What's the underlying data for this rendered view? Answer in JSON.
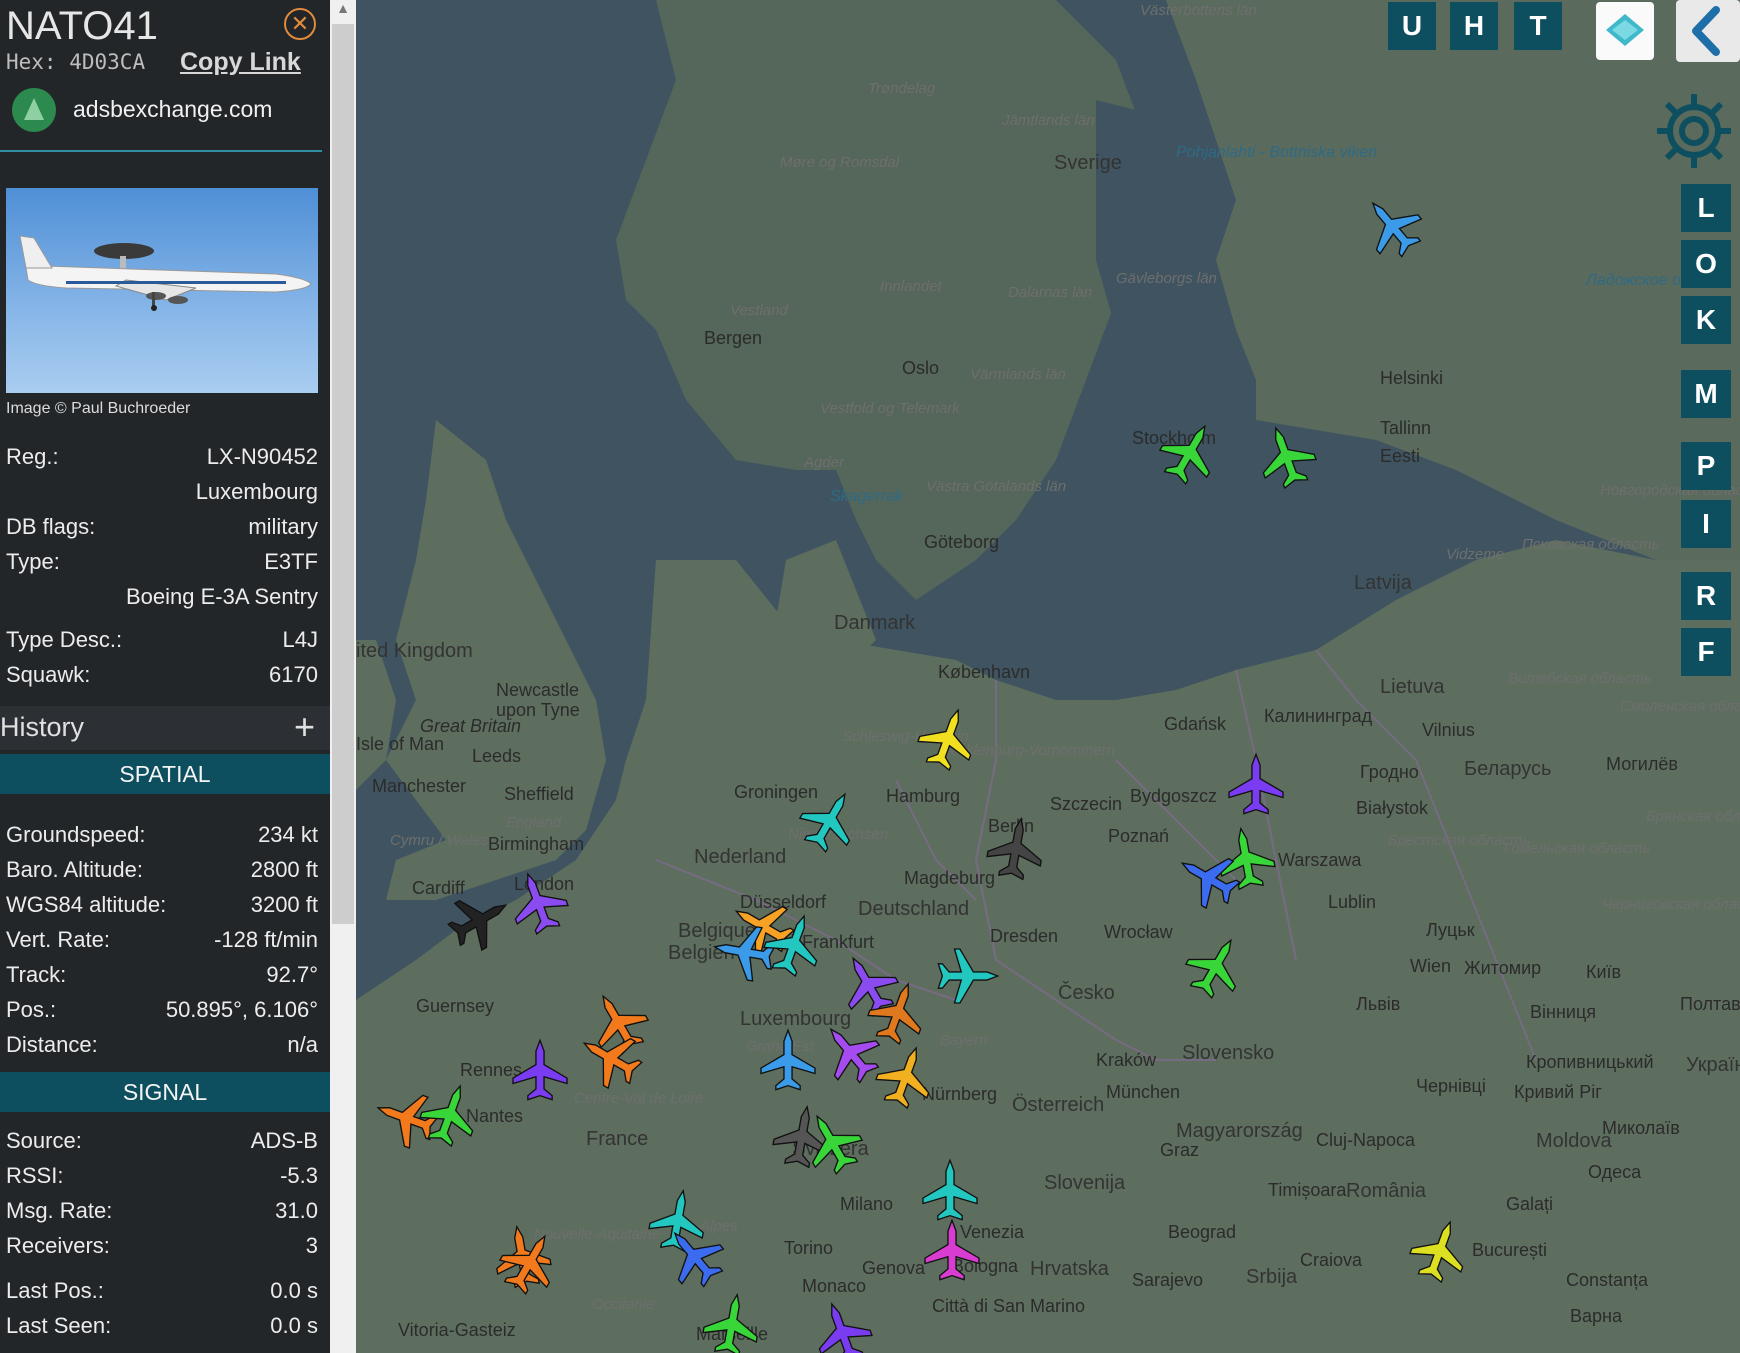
{
  "aircraft": {
    "callsign": "NATO41",
    "hex_label": "Hex:",
    "hex": "4D03CA",
    "copy_link": "Copy Link",
    "site": "adsbexchange.com",
    "photo_credit": "Image © Paul Buchroeder"
  },
  "info": [
    {
      "label": "Reg.:",
      "value": "LX-N90452"
    },
    {
      "label": "",
      "value": "Luxembourg"
    },
    {
      "label": "DB flags:",
      "value": "military"
    },
    {
      "label": "Type:",
      "value": "E3TF"
    },
    {
      "label": "",
      "value": "Boeing E-3A Sentry"
    },
    {
      "label": "Type Desc.:",
      "value": "L4J"
    },
    {
      "label": "Squawk:",
      "value": "6170"
    }
  ],
  "history": {
    "title": "History",
    "expand": "+"
  },
  "spatial": {
    "title": "SPATIAL",
    "rows": [
      {
        "label": "Groundspeed:",
        "value": "234 kt"
      },
      {
        "label": "Baro. Altitude:",
        "value": "2800 ft"
      },
      {
        "label": "WGS84 altitude:",
        "value": "3200 ft"
      },
      {
        "label": "Vert. Rate:",
        "value": "-128 ft/min"
      },
      {
        "label": "Track:",
        "value": "92.7°"
      },
      {
        "label": "Pos.:",
        "value": "50.895°, 6.106°"
      },
      {
        "label": "Distance:",
        "value": "n/a"
      }
    ]
  },
  "signal": {
    "title": "SIGNAL",
    "rows": [
      {
        "label": "Source:",
        "value": "ADS-B"
      },
      {
        "label": "RSSI:",
        "value": "-5.3"
      },
      {
        "label": "Msg. Rate:",
        "value": "31.0"
      },
      {
        "label": "Receivers:",
        "value": "3"
      },
      {
        "label": "Last Pos.:",
        "value": "0.0 s"
      },
      {
        "label": "Last Seen:",
        "value": "0.0 s"
      }
    ]
  },
  "map": {
    "top_buttons": [
      "U",
      "H",
      "T"
    ],
    "right_buttons": [
      "L",
      "O",
      "K",
      "M",
      "P",
      "I",
      "R",
      "F"
    ],
    "labels": {
      "countries": [
        "Sverige",
        "Danmark",
        "Nederland",
        "Deutschland",
        "Belgique",
        "Belgien",
        "Luxembourg",
        "France",
        "Česko",
        "Slovensko",
        "Österreich",
        "Magyarország",
        "România",
        "Slovenija",
        "Hrvatska",
        "Srbija",
        "Latvija",
        "Lietuva",
        "Беларусь",
        "Moldova",
        "Україна",
        "ited Kingdom",
        "Great Britain",
        "Svizzera",
        "Eesti"
      ],
      "cities": [
        "Bergen",
        "Oslo",
        "Stockholm",
        "Helsinki",
        "Tallinn",
        "Göteborg",
        "København",
        "Hamburg",
        "Groningen",
        "Newcastle upon Tyne",
        "Leeds",
        "Manchester",
        "Sheffield",
        "Birmingham",
        "Cardiff",
        "London",
        "Düsseldorf",
        "Frankfurt",
        "Magdeburg",
        "Berlin",
        "Szczecin",
        "Poznań",
        "Bydgoszcz",
        "Gdańsk",
        "Калининград",
        "Vilnius",
        "Гродно",
        "Białystok",
        "Warszawa",
        "Lublin",
        "Wrocław",
        "Dresden",
        "Kraków",
        "Wien",
        "München",
        "Nürnberg",
        "Graz",
        "Milano",
        "Torino",
        "Genova",
        "Monaco",
        "Bologna",
        "Venezia",
        "Rennes",
        "Nantes",
        "Marseille",
        "Cluj-Napoca",
        "Timișoara",
        "Beograd",
        "Sarajevo",
        "Craiova",
        "București",
        "Constanța",
        "Galați",
        "Одеса",
        "Миколаїв",
        "Кривий Ріг",
        "Кропивницький",
        "Вінниця",
        "Житомир",
        "Київ",
        "Полтава",
        "Чернівці",
        "Львів",
        "Луцьк",
        "Могилёв",
        "Città di San Marino",
        "Vitoria-Gasteiz",
        "Варна",
        "Guernsey",
        "Isle of Man"
      ],
      "regions": [
        "Västerbottens län",
        "Trøndelag",
        "Jämtlands län",
        "Møre og Romsdal",
        "Vestland",
        "Innlandet",
        "Dalarnas län",
        "Gävleborgs län",
        "Värmlands län",
        "Vestfold og Telemark",
        "Agder",
        "Västra Götalands län",
        "Pohjanlahti - Bottniska viken",
        "Skagerrak",
        "Schleswig-Holstein",
        "Mecklenburg-Vorpommern",
        "Niedersachsen",
        "England",
        "Cymru / Wales",
        "Bayern",
        "Grand Est",
        "Centre-Val de Loire",
        "Nouvelle-Aquitaine",
        "Occitanie",
        "Alpes",
        "Vidzeme",
        "Псковская область",
        "Новгородская область",
        "Брестская область",
        "Гомельская область",
        "Витебская область",
        "Смоленская область",
        "Брянская область",
        "Черниговская область",
        "Ладожское озеро"
      ]
    },
    "planes": [
      {
        "color": "#3b9be8"
      },
      {
        "color": "#39d639"
      },
      {
        "color": "#39d639"
      },
      {
        "color": "#f0e020"
      },
      {
        "color": "#22c7c0"
      },
      {
        "color": "#444444"
      },
      {
        "color": "#7a3cf0"
      },
      {
        "color": "#39d639"
      },
      {
        "color": "#3b6cf0"
      },
      {
        "color": "#39d639"
      },
      {
        "color": "#222222"
      },
      {
        "color": "#8a4cf0"
      },
      {
        "color": "#f7a224"
      },
      {
        "color": "#3b9be8"
      },
      {
        "color": "#22c7c0"
      },
      {
        "color": "#8a4cf0"
      },
      {
        "color": "#22c7c0"
      },
      {
        "color": "#e0781e"
      },
      {
        "color": "#f27a1c"
      },
      {
        "color": "#f27a1c"
      },
      {
        "color": "#7a3cf0"
      },
      {
        "color": "#3b9be8"
      },
      {
        "color": "#a54cf0"
      },
      {
        "color": "#f0b020"
      },
      {
        "color": "#f27a1c"
      },
      {
        "color": "#39d639"
      },
      {
        "color": "#555555"
      },
      {
        "color": "#39d639"
      },
      {
        "color": "#22c7c0"
      },
      {
        "color": "#22c7c0"
      },
      {
        "color": "#3b6cf0"
      },
      {
        "color": "#d93cd0"
      },
      {
        "color": "#f27a1c"
      },
      {
        "color": "#f27a1c"
      },
      {
        "color": "#dde020"
      },
      {
        "color": "#39d639"
      },
      {
        "color": "#7a3cf0"
      }
    ]
  }
}
